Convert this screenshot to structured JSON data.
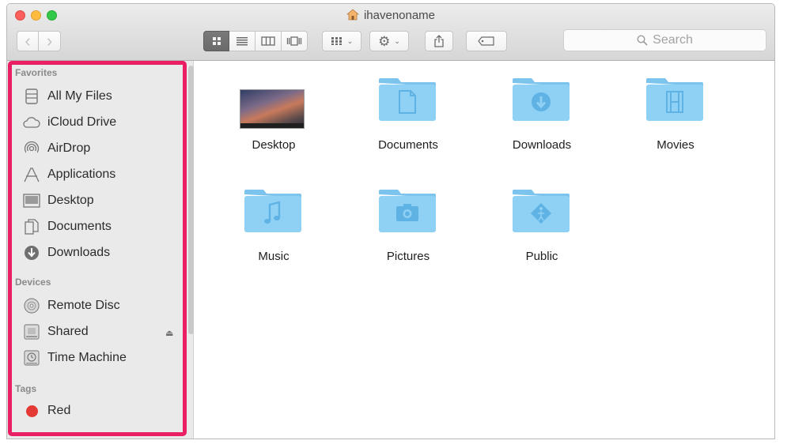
{
  "window": {
    "title": "ihavenoname"
  },
  "toolbar": {
    "back_label": "‹",
    "forward_label": "›",
    "search_placeholder": "Search"
  },
  "sidebar": {
    "favorites_heading": "Favorites",
    "favorites": [
      {
        "label": "All My Files",
        "icon": "all-files-icon"
      },
      {
        "label": "iCloud Drive",
        "icon": "cloud-icon"
      },
      {
        "label": "AirDrop",
        "icon": "airdrop-icon"
      },
      {
        "label": "Applications",
        "icon": "applications-icon"
      },
      {
        "label": "Desktop",
        "icon": "desktop-icon"
      },
      {
        "label": "Documents",
        "icon": "documents-icon"
      },
      {
        "label": "Downloads",
        "icon": "downloads-icon"
      }
    ],
    "devices_heading": "Devices",
    "devices": [
      {
        "label": "Remote Disc",
        "icon": "disc-icon"
      },
      {
        "label": "Shared",
        "icon": "shared-icon"
      },
      {
        "label": "Time Machine",
        "icon": "time-machine-icon"
      }
    ],
    "tags_heading": "Tags",
    "tags": [
      {
        "label": "Red",
        "color": "#e53935"
      }
    ],
    "highlight_color": "#e91e63"
  },
  "files": [
    {
      "label": "Desktop",
      "kind": "thumbnail"
    },
    {
      "label": "Documents",
      "kind": "folder",
      "glyph": "document-glyph-icon"
    },
    {
      "label": "Downloads",
      "kind": "folder",
      "glyph": "download-glyph-icon"
    },
    {
      "label": "Movies",
      "kind": "folder",
      "glyph": "film-glyph-icon"
    },
    {
      "label": "Music",
      "kind": "folder",
      "glyph": "music-glyph-icon"
    },
    {
      "label": "Pictures",
      "kind": "folder",
      "glyph": "camera-glyph-icon"
    },
    {
      "label": "Public",
      "kind": "folder",
      "glyph": "public-glyph-icon"
    }
  ],
  "colors": {
    "folder_fill": "#8fd0f5",
    "folder_tab": "#7cc3ee",
    "folder_glyph": "#5fb2e4"
  }
}
